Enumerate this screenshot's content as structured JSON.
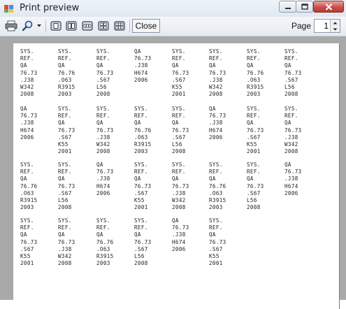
{
  "window": {
    "title": "Print preview",
    "icon": "print-preview-app-icon",
    "controls": [
      "minimize-icon",
      "maximize-icon",
      "close-icon"
    ]
  },
  "toolbar": {
    "print_icon": "printer-icon",
    "zoom_icon": "magnifier-icon",
    "layout_icons": [
      "one-page-icon",
      "two-pages-icon",
      "three-pages-icon",
      "four-pages-icon",
      "six-pages-icon"
    ],
    "close_label": "Close",
    "page_label": "Page",
    "page_value": "1"
  },
  "labels": [
    [
      "SYS.",
      "REF.",
      "QA",
      "76.73",
      ".J38",
      "W342",
      "2008"
    ],
    [
      "SYS.",
      "REF.",
      "QA",
      "76.76",
      ".O63",
      "R3915",
      "2003"
    ],
    [
      "SYS.",
      "REF.",
      "QA",
      "76.73",
      ".S67",
      "L56",
      "2008"
    ],
    [
      "QA",
      "76.73",
      ".J38",
      "H674",
      "2006"
    ],
    [
      "SYS.",
      "REF.",
      "QA",
      "76.73",
      ".S67",
      "K55",
      "2001"
    ],
    [
      "SYS.",
      "REF.",
      "QA",
      "76.73",
      ".J38",
      "W342",
      "2008"
    ],
    [
      "SYS.",
      "REF.",
      "QA",
      "76.76",
      ".O63",
      "R3915",
      "2003"
    ],
    [
      "SYS.",
      "REF.",
      "QA",
      "76.73",
      ".S67",
      "L56",
      "2008"
    ],
    [
      "QA",
      "76.73",
      ".J38",
      "H674",
      "2006"
    ],
    [
      "SYS.",
      "REF.",
      "QA",
      "76.73",
      ".S67",
      "K55",
      "2001"
    ],
    [
      "SYS.",
      "REF.",
      "QA",
      "76.73",
      ".J38",
      "W342",
      "2008"
    ],
    [
      "SYS.",
      "REF.",
      "QA",
      "76.76",
      ".O63",
      "R3915",
      "2003"
    ],
    [
      "SYS.",
      "REF.",
      "QA",
      "76.73",
      ".S67",
      "L56",
      "2008"
    ],
    [
      "QA",
      "76.73",
      ".J38",
      "H674",
      "2006"
    ],
    [
      "SYS.",
      "REF.",
      "QA",
      "76.73",
      ".S67",
      "K55",
      "2001"
    ],
    [
      "SYS.",
      "REF.",
      "QA",
      "76.73",
      ".J38",
      "W342",
      "2008"
    ],
    [
      "SYS.",
      "REF.",
      "QA",
      "76.76",
      ".O63",
      "R3915",
      "2003"
    ],
    [
      "SYS.",
      "REF.",
      "QA",
      "76.73",
      ".S67",
      "L56",
      "2008"
    ],
    [
      "QA",
      "76.73",
      ".J38",
      "H674",
      "2006"
    ],
    [
      "SYS.",
      "REF.",
      "QA",
      "76.73",
      ".S67",
      "K55",
      "2001"
    ],
    [
      "SYS.",
      "REF.",
      "QA",
      "76.73",
      ".J38",
      "W342",
      "2008"
    ],
    [
      "SYS.",
      "REF.",
      "QA",
      "76.76",
      ".O63",
      "R3915",
      "2003"
    ],
    [
      "SYS.",
      "REF.",
      "QA",
      "76.73",
      ".S67",
      "L56",
      "2008"
    ],
    [
      "QA",
      "76.73",
      ".J38",
      "H674",
      "2006"
    ],
    [
      "SYS.",
      "REF.",
      "QA",
      "76.73",
      ".S67",
      "K55",
      "2001"
    ],
    [
      "SYS.",
      "REF.",
      "QA",
      "76.73",
      ".J38",
      "W342",
      "2008"
    ],
    [
      "SYS.",
      "REF.",
      "QA",
      "76.76",
      ".O63",
      "R3915",
      "2003"
    ],
    [
      "SYS.",
      "REF.",
      "QA",
      "76.73",
      ".S67",
      "L56",
      "2008"
    ],
    [
      "QA",
      "76.73",
      ".J38",
      "H674",
      "2006"
    ],
    [
      "SYS.",
      "REF.",
      "QA",
      "76.73",
      ".S67",
      "K55",
      "2001"
    ]
  ]
}
